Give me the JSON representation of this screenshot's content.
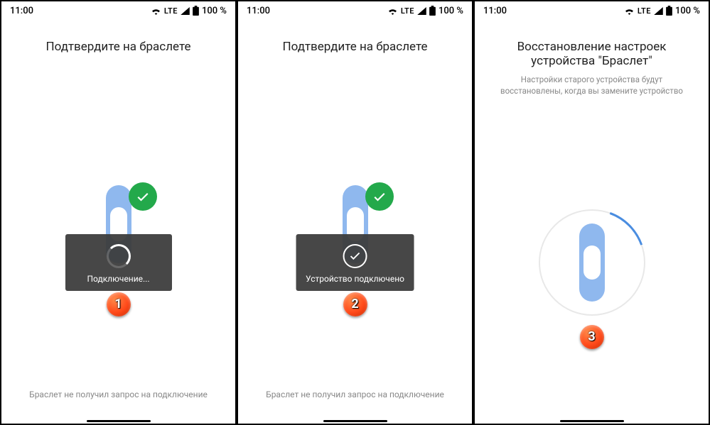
{
  "status": {
    "time": "11:00",
    "lte": "LTE",
    "battery": "100 %"
  },
  "screens": [
    {
      "title": "Подтвердите на браслете",
      "toast": "Подключение...",
      "bottom": "Браслет не получил запрос на подключение",
      "marker": "1"
    },
    {
      "title": "Подтвердите на браслете",
      "toast": "Устройство подключено",
      "bottom": "Браслет не получил запрос на подключение",
      "marker": "2"
    },
    {
      "title": "Восстановление настроек устройства \"Браслет\"",
      "subtitle": "Настройки старого устройства будут восстановлены, когда вы замените устройство",
      "marker": "3"
    }
  ]
}
